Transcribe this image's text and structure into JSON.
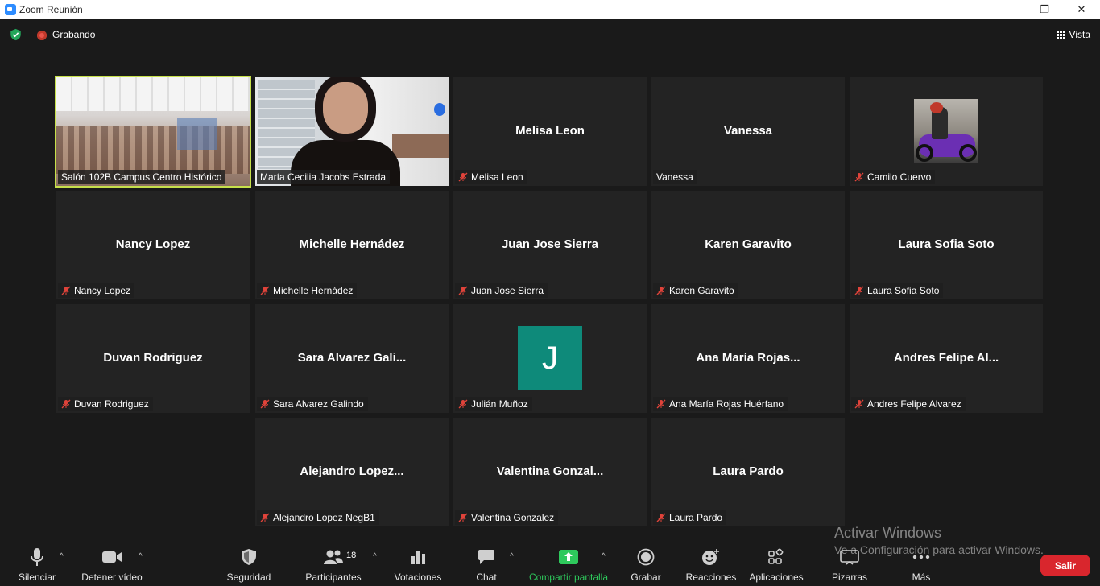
{
  "window": {
    "title": "Zoom Reunión",
    "minimize": "—",
    "restore": "❐",
    "close": "✕"
  },
  "topbar": {
    "recording_label": "Grabando",
    "view_label": "Vista"
  },
  "participants": [
    {
      "name": "Salón 102B Campus Centro Histórico",
      "kind": "video-room",
      "muted": false,
      "active": true
    },
    {
      "name": "María Cecilia Jacobs Estrada",
      "kind": "video-woman",
      "muted": false
    },
    {
      "name": "Melisa Leon",
      "display": "Melisa Leon",
      "kind": "name",
      "muted": true
    },
    {
      "name": "Vanessa",
      "display": "Vanessa",
      "kind": "name",
      "muted": false
    },
    {
      "name": "Camilo Cuervo",
      "kind": "photo",
      "muted": true
    },
    {
      "name": "Nancy Lopez",
      "display": "Nancy Lopez",
      "kind": "name",
      "muted": true
    },
    {
      "name": "Michelle Hernádez",
      "display": "Michelle Hernádez",
      "kind": "name",
      "muted": true
    },
    {
      "name": "Juan Jose Sierra",
      "display": "Juan Jose Sierra",
      "kind": "name",
      "muted": true
    },
    {
      "name": "Karen Garavito",
      "display": "Karen Garavito",
      "kind": "name",
      "muted": true
    },
    {
      "name": "Laura Sofia Soto",
      "display": "Laura Sofia Soto",
      "kind": "name",
      "muted": true
    },
    {
      "name": "Duvan Rodriguez",
      "display": "Duvan Rodriguez",
      "kind": "name",
      "muted": true
    },
    {
      "name": "Sara Alvarez Galindo",
      "display": "Sara Alvarez Gali...",
      "kind": "name",
      "muted": true
    },
    {
      "name": "Julián Muñoz",
      "initial": "J",
      "kind": "initial",
      "muted": true
    },
    {
      "name": "Ana María Rojas Huérfano",
      "display": "Ana María Rojas...",
      "kind": "name",
      "muted": true
    },
    {
      "name": "Andres Felipe Alvarez",
      "display": "Andres Felipe Al...",
      "kind": "name",
      "muted": true
    },
    {
      "name": "Alejandro Lopez NegB1",
      "display": "Alejandro Lopez...",
      "kind": "name",
      "muted": true
    },
    {
      "name": "Valentina Gonzalez",
      "display": "Valentina Gonzal...",
      "kind": "name",
      "muted": true
    },
    {
      "name": "Laura Pardo",
      "display": "Laura Pardo",
      "kind": "name",
      "muted": true
    }
  ],
  "toolbar": {
    "mute": "Silenciar",
    "video": "Detener vídeo",
    "security": "Seguridad",
    "participants": "Participantes",
    "participants_count": "18",
    "polls": "Votaciones",
    "chat": "Chat",
    "share": "Compartir pantalla",
    "record": "Grabar",
    "reactions": "Reacciones",
    "apps": "Aplicaciones",
    "whiteboards": "Pizarras",
    "more": "Más",
    "leave": "Salir",
    "caret": "^"
  },
  "watermark": {
    "line1": "Activar Windows",
    "line2": "Ve a Configuración para activar Windows."
  },
  "colors": {
    "share_green": "#2ec95c",
    "leave_red": "#d9262d",
    "active_border": "#c6e04a",
    "avatar_teal": "#0e8a7a"
  }
}
